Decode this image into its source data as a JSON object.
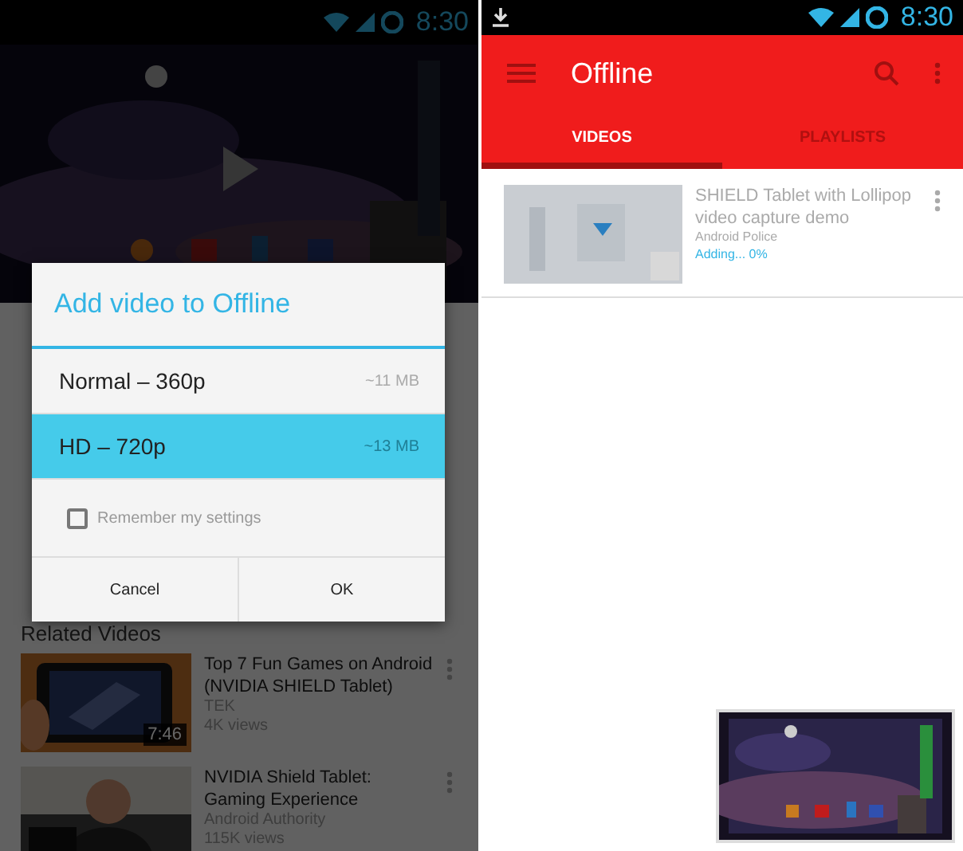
{
  "left": {
    "status_bar": {
      "time": "8:30"
    },
    "dialog": {
      "title": "Add video to Offline",
      "options": [
        {
          "label": "Normal – 360p",
          "size": "~11 MB",
          "selected": false
        },
        {
          "label": "HD – 720p",
          "size": "~13 MB",
          "selected": true
        }
      ],
      "remember": {
        "label": "Remember my settings",
        "checked": false
      },
      "buttons": [
        "Cancel",
        "OK"
      ]
    },
    "related": {
      "heading": "Related Videos",
      "videos": [
        {
          "title": "Top 7 Fun Games on Android (NVIDIA SHIELD Tablet)",
          "channel": "TEK",
          "views": "4K views",
          "duration": "7:46"
        },
        {
          "title": "NVIDIA Shield Tablet: Gaming Experience",
          "channel": "Android Authority",
          "views": "115K views"
        }
      ]
    }
  },
  "right": {
    "status_bar": {
      "time": "8:30"
    },
    "toolbar": {
      "title": "Offline"
    },
    "tabs": [
      {
        "label": "VIDEOS",
        "selected": true
      },
      {
        "label": "PLAYLISTS",
        "selected": false
      }
    ],
    "videos": [
      {
        "title": "SHIELD Tablet with Lollipop video capture demo",
        "channel": "Android Police",
        "status": "Adding... 0%"
      }
    ]
  }
}
